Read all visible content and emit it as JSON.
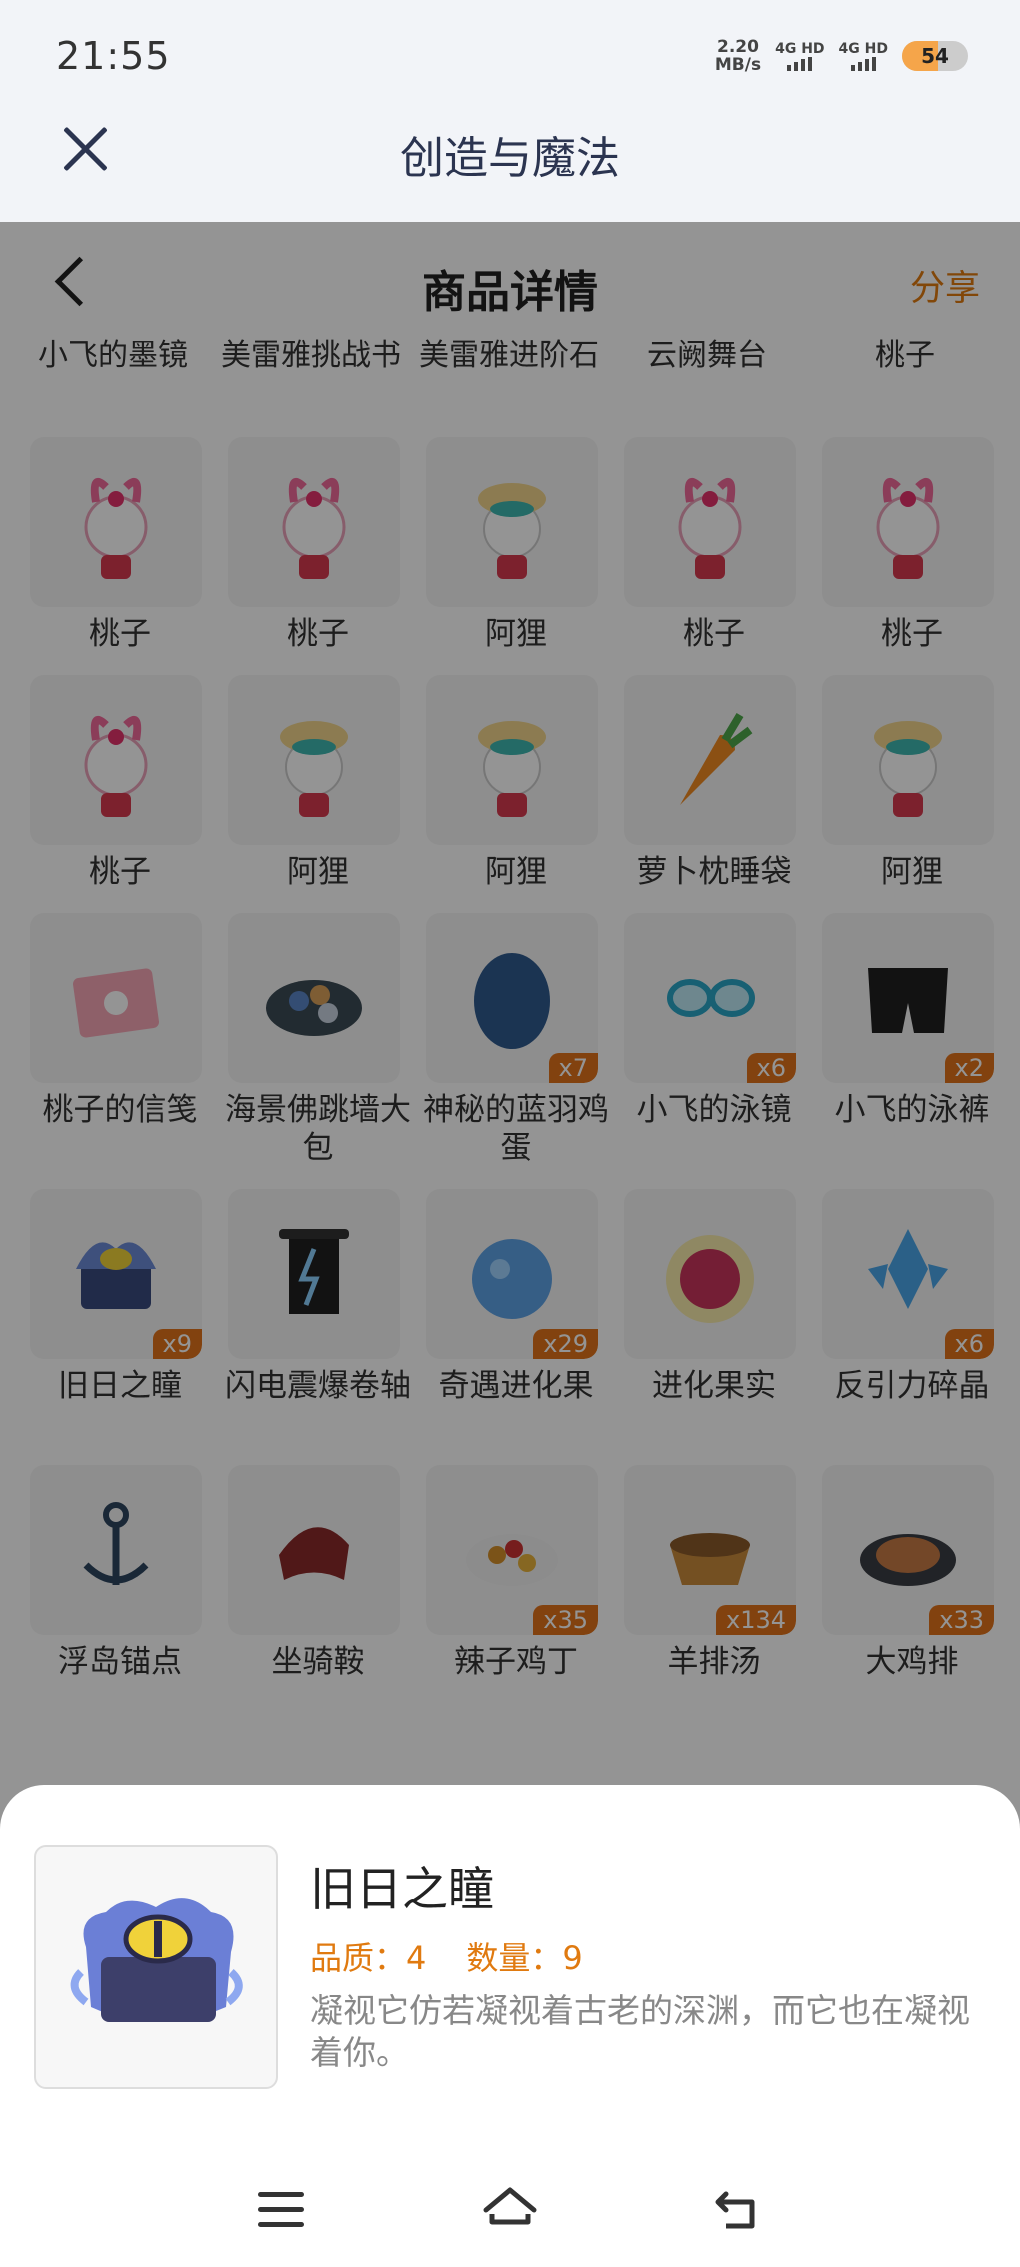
{
  "status": {
    "time": "21:55",
    "speed": "2.20",
    "speed_unit": "MB/s",
    "net1": "4G HD",
    "net2": "4G HD",
    "battery": "54"
  },
  "app": {
    "title": "创造与魔法"
  },
  "page": {
    "title": "商品详情",
    "share": "分享"
  },
  "partial_row": [
    "小飞的墨镜",
    "美雷雅挑战书",
    "美雷雅进阶石",
    "云阙舞台",
    "桃子"
  ],
  "items": [
    {
      "label": "桃子",
      "qty": "",
      "icon": "peach-pet-icon"
    },
    {
      "label": "桃子",
      "qty": "",
      "icon": "peach-pet-icon"
    },
    {
      "label": "阿狸",
      "qty": "",
      "icon": "ali-pet-icon"
    },
    {
      "label": "桃子",
      "qty": "",
      "icon": "peach-pet-icon"
    },
    {
      "label": "桃子",
      "qty": "",
      "icon": "peach-pet-icon"
    },
    {
      "label": "桃子",
      "qty": "",
      "icon": "peach-pet-icon"
    },
    {
      "label": "阿狸",
      "qty": "",
      "icon": "ali-pet-icon"
    },
    {
      "label": "阿狸",
      "qty": "",
      "icon": "ali-pet-icon"
    },
    {
      "label": "萝卜枕睡袋",
      "qty": "",
      "icon": "carrot-icon"
    },
    {
      "label": "阿狸",
      "qty": "",
      "icon": "ali-pet-icon"
    },
    {
      "label": "桃子的信笺",
      "qty": "",
      "icon": "letter-icon"
    },
    {
      "label": "海景佛跳墙大包",
      "qty": "",
      "icon": "dish-icon"
    },
    {
      "label": "神秘的蓝羽鸡蛋",
      "qty": "x7",
      "icon": "egg-icon"
    },
    {
      "label": "小飞的泳镜",
      "qty": "x6",
      "icon": "goggles-icon"
    },
    {
      "label": "小飞的泳裤",
      "qty": "x2",
      "icon": "swim-trunks-icon"
    },
    {
      "label": "旧日之瞳",
      "qty": "x9",
      "icon": "eye-chest-icon"
    },
    {
      "label": "闪电震爆卷轴",
      "qty": "",
      "icon": "scroll-icon"
    },
    {
      "label": "奇遇进化果",
      "qty": "x29",
      "icon": "blue-fruit-icon"
    },
    {
      "label": "进化果实",
      "qty": "",
      "icon": "red-fruit-icon"
    },
    {
      "label": "反引力碎晶",
      "qty": "x6",
      "icon": "crystal-icon"
    },
    {
      "label": "浮岛锚点",
      "qty": "",
      "icon": "anchor-icon"
    },
    {
      "label": "坐骑鞍",
      "qty": "",
      "icon": "saddle-icon"
    },
    {
      "label": "辣子鸡丁",
      "qty": "x35",
      "icon": "chicken-dish-icon"
    },
    {
      "label": "羊排汤",
      "qty": "x134",
      "icon": "soup-icon"
    },
    {
      "label": "大鸡排",
      "qty": "x33",
      "icon": "cutlet-icon"
    }
  ],
  "detail": {
    "name": "旧日之瞳",
    "quality_label": "品质：",
    "quality": "4",
    "count_label": "数量：",
    "count": "9",
    "description": "凝视它仿若凝视着古老的深渊，而它也在凝视着你。"
  }
}
